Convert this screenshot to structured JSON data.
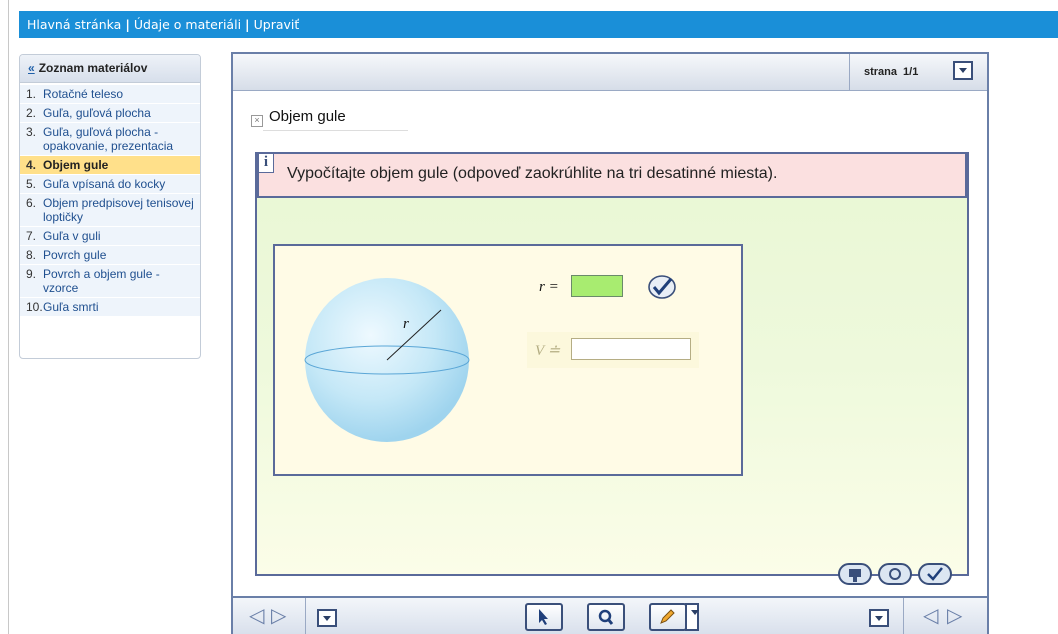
{
  "breadcrumb": {
    "home": "Hlavná stránka",
    "details": "Údaje o materiáli",
    "edit": "Upraviť",
    "separator": "|"
  },
  "sidebar": {
    "back_symbol": "«",
    "title": "Zoznam materiálov",
    "items": [
      {
        "num": "1.",
        "label": "Rotačné teleso"
      },
      {
        "num": "2.",
        "label": "Guľa, guľová plocha"
      },
      {
        "num": "3.",
        "label": "Guľa, guľová plocha - opakovanie, prezentacia"
      },
      {
        "num": "4.",
        "label": "Objem gule",
        "active": true
      },
      {
        "num": "5.",
        "label": "Guľa vpísaná do kocky"
      },
      {
        "num": "6.",
        "label": "Objem predpisovej tenisovej loptičky"
      },
      {
        "num": "7.",
        "label": "Guľa v guli"
      },
      {
        "num": "8.",
        "label": "Povrch gule"
      },
      {
        "num": "9.",
        "label": "Povrch a objem gule - vzorce"
      },
      {
        "num": "10.",
        "label": "Guľa smrti"
      }
    ]
  },
  "header": {
    "page_label": "strana",
    "page_value": "1/1"
  },
  "material": {
    "title": "Objem gule",
    "info_icon": "i",
    "task": "Vypočítajte objem gule (odpoveď zaokrúhlite na tri desatinné miesta).",
    "radius_label": "r =",
    "radius_value": "",
    "volume_label": "V ≐",
    "volume_value": "",
    "sphere_radius_label": "r"
  },
  "icons": {
    "breadcrumb_back": "double-left-arrow",
    "check": "checkmark-icon",
    "close": "close-x-icon"
  },
  "colors": {
    "topbar": "#1a8fd8",
    "active_item": "#ffe08a",
    "task_bg": "#fbe0e0",
    "radius_input": "#a8ec70"
  }
}
